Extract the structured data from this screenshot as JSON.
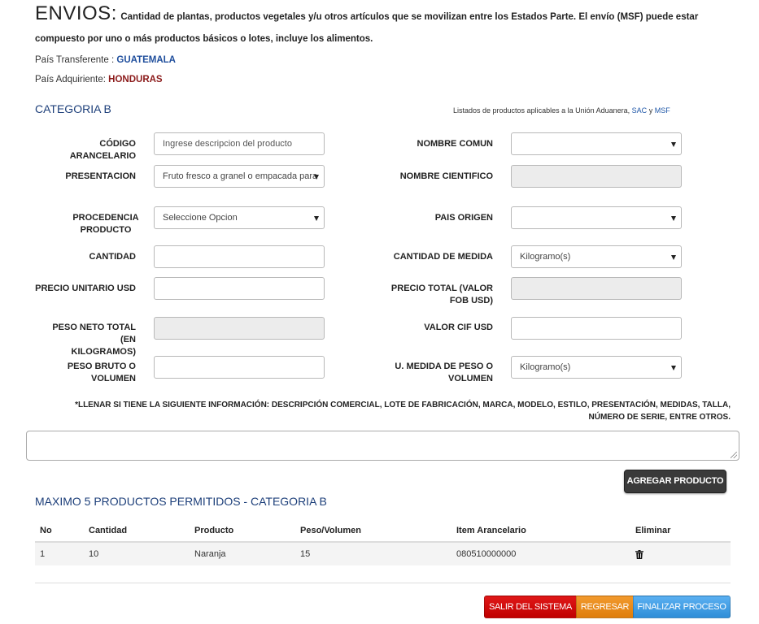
{
  "header": {
    "title": "ENVIOS:",
    "description": "Cantidad de plantas, productos vegetales y/u otros artículos que se movilizan entre los Estados Parte. El envío (MSF) puede estar compuesto por uno o más productos básicos o lotes, incluye los alimentos."
  },
  "countries": {
    "transfer_label": "País Transferente :",
    "transfer_value": "GUATEMALA",
    "acquire_label": "País Adquiriente:",
    "acquire_value": "HONDURAS"
  },
  "category": {
    "title": "CATEGORIA B",
    "listados_text": "Listados de productos aplicables a la Unión Aduanera,",
    "link_sac": "SAC",
    "link_and": "y",
    "link_msf": "MSF"
  },
  "form": {
    "codigo_label": "CÓDIGO ARANCELARIO",
    "codigo_placeholder": "Ingrese descripcion del producto",
    "nombre_comun_label": "NOMBRE COMUN",
    "nombre_comun_value": "",
    "presentacion_label": "PRESENTACION",
    "presentacion_value": "Fruto fresco a granel o empacada para",
    "nombre_cientifico_label": "NOMBRE CIENTIFICO",
    "nombre_cientifico_value": "",
    "procedencia_label_1": "PROCEDENCIA",
    "procedencia_label_2": "PRODUCTO",
    "procedencia_value": "Seleccione Opcion",
    "pais_origen_label": "PAIS ORIGEN",
    "pais_origen_value": "",
    "cantidad_label": "CANTIDAD",
    "cantidad_value": "",
    "cantidad_medida_label": "CANTIDAD DE MEDIDA",
    "cantidad_medida_value": "Kilogramo(s)",
    "precio_unitario_label": "PRECIO UNITARIO USD",
    "precio_unitario_value": "",
    "precio_total_label_1": "PRECIO TOTAL (VALOR",
    "precio_total_label_2": "FOB USD)",
    "precio_total_value": "",
    "peso_neto_label_1": "PESO NETO TOTAL (EN",
    "peso_neto_label_2": "KILOGRAMOS)",
    "peso_neto_value": "",
    "valor_cif_label": "VALOR CIF USD",
    "valor_cif_value": "",
    "peso_bruto_label_1": "PESO BRUTO O",
    "peso_bruto_label_2": "VOLUMEN",
    "peso_bruto_value": "",
    "umedida_label_1": "U. MEDIDA DE PESO O",
    "umedida_label_2": "VOLUMEN",
    "umedida_value": "Kilogramo(s)"
  },
  "note": "*LLENAR SI TIENE LA SIGUIENTE INFORMACIÓN: DESCRIPCIÓN COMERCIAL, LOTE DE FABRICACIÓN, MARCA, MODELO, ESTILO, PRESENTACIÓN, MEDIDAS, TALLA, NÚMERO DE SERIE, ENTRE OTROS.",
  "buttons": {
    "agregar": "AGREGAR PRODUCTO",
    "salir": "SALIR DEL SISTEMA",
    "regresar": "REGRESAR",
    "finalizar": "FINALIZAR PROCESO"
  },
  "table": {
    "title": "MAXIMO 5 PRODUCTOS PERMITIDOS - CATEGORIA B",
    "headers": [
      "No",
      "Cantidad",
      "Producto",
      "Peso/Volumen",
      "Item Arancelario",
      "Eliminar"
    ],
    "rows": [
      {
        "no": "1",
        "cantidad": "10",
        "producto": "Naranja",
        "peso": "15",
        "item": "080510000000",
        "eliminar_icon": "trash-icon"
      }
    ]
  },
  "colors": {
    "transfer": "#1f4e9c",
    "acquire": "#8b1a1a",
    "section_title": "#1d3f7a",
    "salir": "#d00000",
    "regresar": "#ea8b1c",
    "finalizar": "#3f9ce4",
    "agregar": "#3a3a3a"
  }
}
